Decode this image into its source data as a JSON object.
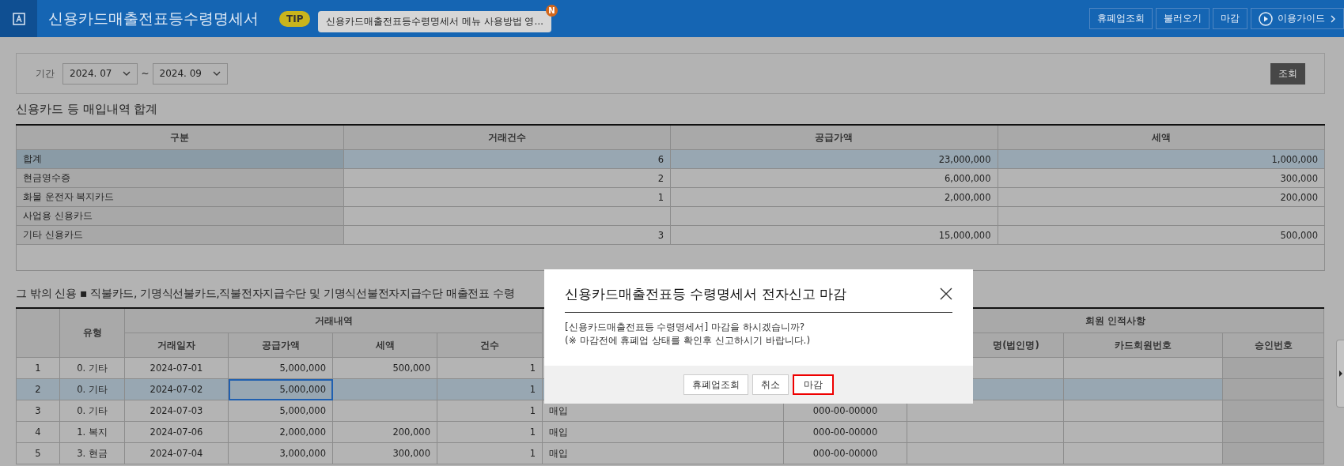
{
  "app": {
    "title": "신용카드매출전표등수령명세서",
    "tip_badge": "TIP",
    "tip_text": "신용카드매출전표등수령명세서 메뉴 사용방법 영…",
    "tip_new_badge": "N",
    "actions": [
      {
        "label": "휴폐업조회",
        "kind": "plain"
      },
      {
        "label": "불러오기",
        "kind": "plain"
      },
      {
        "label": "마감",
        "kind": "plain"
      },
      {
        "label": "이용가이드",
        "kind": "guide"
      }
    ]
  },
  "filter": {
    "label": "기간",
    "from": "2024. 07",
    "separator": "~",
    "to": "2024. 09",
    "search_button": "조회"
  },
  "summary": {
    "title": "신용카드 등 매입내역 합계",
    "columns": [
      "구분",
      "거래건수",
      "공급가액",
      "세액"
    ],
    "rows": [
      {
        "cells": [
          "합계",
          "6",
          "23,000,000",
          "1,000,000"
        ],
        "selected": true
      },
      {
        "cells": [
          "현금영수증",
          "2",
          "6,000,000",
          "300,000"
        ],
        "selected": false
      },
      {
        "cells": [
          "화물 운전자 복지카드",
          "1",
          "2,000,000",
          "200,000"
        ],
        "selected": false
      },
      {
        "cells": [
          "사업용 신용카드",
          "",
          "",
          ""
        ],
        "selected": false
      },
      {
        "cells": [
          "기타 신용카드",
          "3",
          "15,000,000",
          "500,000"
        ],
        "selected": false
      }
    ]
  },
  "detail": {
    "title": "그 밖의 신용 ▪ 직불카드, 기명식선불카드,직불전자지급수단 및 기명식선불전자지급수단 매출전표 수령",
    "group_headers": [
      "거래내역",
      "회원 인적사항"
    ],
    "columns": [
      "유형",
      "거래일자",
      "공급가액",
      "세액",
      "건수",
      "명(법인명)",
      "카드회원번호",
      "승인번호"
    ],
    "rows": [
      {
        "no": "1",
        "type": "0. 기타",
        "date": "2024-07-01",
        "supply": "5,000,000",
        "tax": "500,000",
        "count": "1",
        "selected": false,
        "supply_focused": false
      },
      {
        "no": "2",
        "type": "0. 기타",
        "date": "2024-07-02",
        "supply": "5,000,000",
        "count": "1",
        "selected": true,
        "supply_focused": true
      },
      {
        "no": "3",
        "type": "0. 기타",
        "date": "2024-07-03",
        "supply": "5,000,000",
        "count": "1",
        "purchase": "매입",
        "biz_no": "000-00-00000",
        "selected": false,
        "supply_focused": false
      },
      {
        "no": "4",
        "type": "1. 복지",
        "date": "2024-07-06",
        "supply": "2,000,000",
        "tax": "200,000",
        "count": "1",
        "purchase": "매입",
        "biz_no": "000-00-00000",
        "selected": false,
        "supply_focused": false
      },
      {
        "no": "5",
        "type": "3. 현금",
        "date": "2024-07-04",
        "supply": "3,000,000",
        "tax": "300,000",
        "count": "1",
        "purchase": "매입",
        "biz_no": "000-00-00000",
        "selected": false,
        "supply_focused": false
      }
    ]
  },
  "dialog": {
    "title": "신용카드매출전표등 수령명세서 전자신고 마감",
    "message": [
      "[신용카드매출전표등 수령명세서] 마감을 하시겠습니까?",
      "(※ 마감전에 휴폐업 상태를 확인후 신고하시기 바랍니다.)"
    ],
    "buttons": [
      {
        "label": "휴폐업조회",
        "selected": false
      },
      {
        "label": "취소",
        "selected": false
      },
      {
        "label": "마감",
        "selected": true
      }
    ]
  }
}
